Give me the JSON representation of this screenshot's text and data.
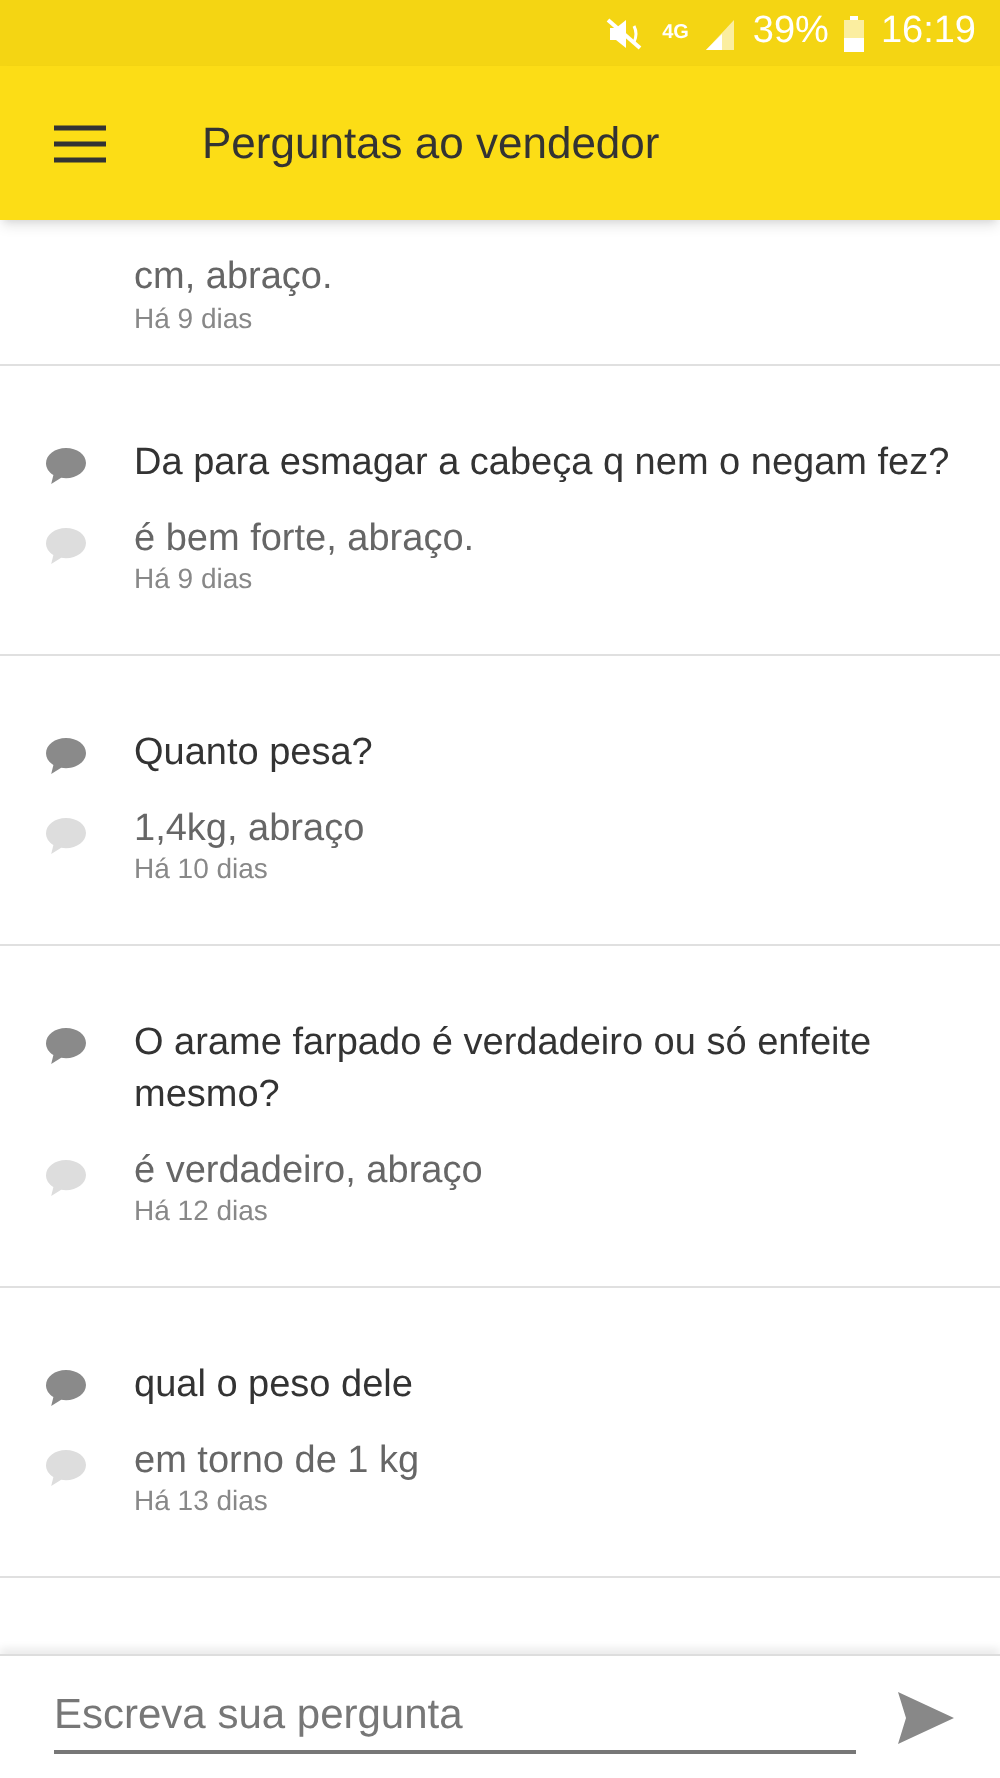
{
  "status_bar": {
    "network": "4G",
    "battery": "39%",
    "time": "16:19"
  },
  "header": {
    "title": "Perguntas ao vendedor"
  },
  "partial_item": {
    "answer": "cm, abraço.",
    "date": "Há 9 dias"
  },
  "questions": [
    {
      "question": "Da para esmagar a cabeça q nem o negam fez?",
      "answer": "é bem forte, abraço.",
      "date": "Há 9 dias"
    },
    {
      "question": "Quanto pesa?",
      "answer": "1,4kg, abraço",
      "date": "Há 10 dias"
    },
    {
      "question": "O arame farpado é verdadeiro ou só enfeite mesmo?",
      "answer": "é verdadeiro, abraço",
      "date": "Há 12 dias"
    },
    {
      "question": "qual o peso dele",
      "answer": "em torno de 1 kg",
      "date": "Há 13 dias"
    }
  ],
  "composer": {
    "placeholder": "Escreva sua pergunta"
  }
}
